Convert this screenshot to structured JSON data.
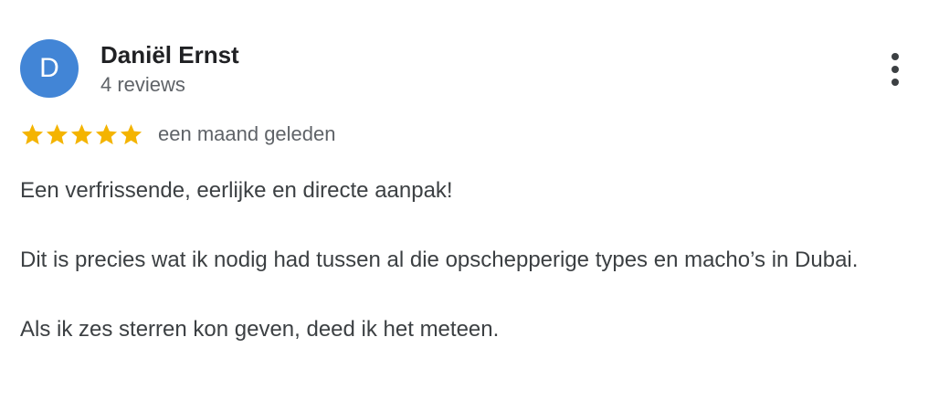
{
  "reviewer": {
    "avatar_letter": "D",
    "avatar_color": "#4285d6",
    "name": "Daniël Ernst",
    "review_count": "4 reviews"
  },
  "menu": {
    "icon": "more-vert-icon"
  },
  "rating": {
    "stars": 5,
    "max_stars": 5,
    "star_color": "#f4b400",
    "icon": "star-icon",
    "date": "een maand geleden"
  },
  "review": {
    "paragraphs": [
      "Een verfrissende, eerlijke en directe aanpak!",
      "Dit is precies wat ik nodig had tussen al die opschepperige types en macho’s in Dubai.",
      "Als ik zes sterren kon geven, deed ik het meteen."
    ]
  }
}
